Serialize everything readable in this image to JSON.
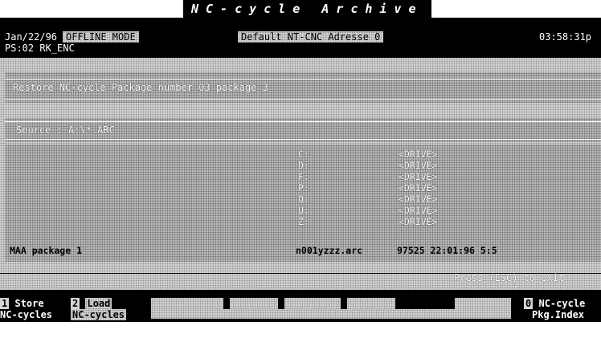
{
  "app": {
    "title": "NC-cycle Archive"
  },
  "header": {
    "date": "Jan/22/96",
    "mode": "OFFLINE MODE",
    "address": "Default NT-CNC Adresse 0",
    "time": "03:58:31p",
    "ps": "PS:02 RK_ENC"
  },
  "panel": {
    "title": "Restore NC-cycle Package number 03 package 3"
  },
  "source": {
    "label": "Source",
    "value": "A:\\*.ARC"
  },
  "drives": [
    {
      "letter": "C:",
      "tag": "<DRIVE>"
    },
    {
      "letter": "D:",
      "tag": "<DRIVE>"
    },
    {
      "letter": "F:",
      "tag": "<DRIVE>"
    },
    {
      "letter": "P:",
      "tag": "<DRIVE>"
    },
    {
      "letter": "Q:",
      "tag": "<DRIVE>"
    },
    {
      "letter": "U:",
      "tag": "<DRIVE>"
    },
    {
      "letter": "Z:",
      "tag": "<DRIVE>"
    }
  ],
  "package_row": {
    "name": "MAA package 1",
    "file": "n001yzzz.arc",
    "meta": "97525 22:01:96 5:5"
  },
  "status": {
    "press_esc": "Press (ESC) to exit"
  },
  "fkeys": [
    {
      "num": "1",
      "line1": "Store",
      "line2": "NC-cycles"
    },
    {
      "num": "2",
      "line1": "Load",
      "line2": "NC-cycles"
    },
    {
      "num": "0",
      "line1": "NC-cycle",
      "line2": "Pkg.Index"
    }
  ],
  "colors": {
    "background": "#ffffff",
    "screen_black": "#000000",
    "dither": "#cfcfcf"
  }
}
